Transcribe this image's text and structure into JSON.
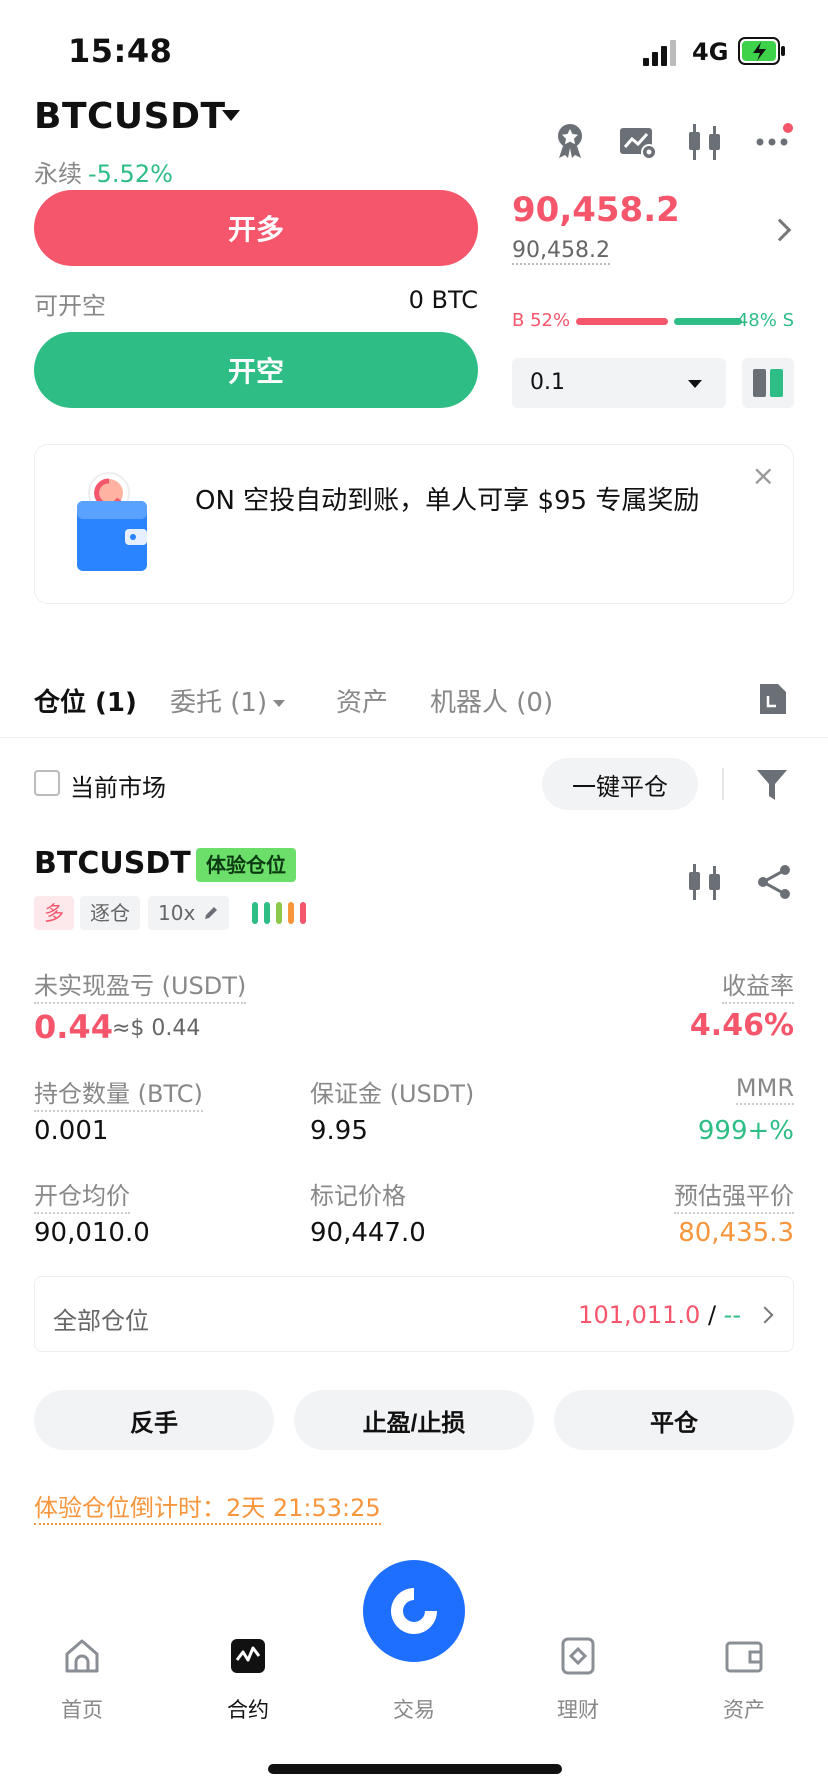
{
  "status": {
    "time": "15:48",
    "network": "4G"
  },
  "header": {
    "pair": "BTCUSDT",
    "contract_type": "永续",
    "change": "-5.52%"
  },
  "order": {
    "long_label": "开多",
    "short_label": "开空",
    "available_label": "可开空",
    "available_value": "0 BTC",
    "quantity": "0.1"
  },
  "price": {
    "last": "90,458.2",
    "mark": "90,458.2"
  },
  "ratio": {
    "buy_label": "B 52%",
    "sell_label": "48% S",
    "buy_pct": 52,
    "sell_pct": 48
  },
  "banner": {
    "text": "ON 空投自动到账，单人可享 $95 专属奖励",
    "close": "×"
  },
  "tabs": [
    {
      "label": "仓位 (1)"
    },
    {
      "label": "委托 (1)"
    },
    {
      "label": "资产"
    },
    {
      "label": "机器人 (0)"
    }
  ],
  "filter": {
    "current_market": "当前市场",
    "close_all": "一键平仓"
  },
  "position": {
    "symbol": "BTCUSDT",
    "tag": "体验仓位",
    "side": "多",
    "margin_mode": "逐仓",
    "leverage": "10x",
    "pnl_label": "未实现盈亏 (USDT)",
    "pnl": "0.44",
    "pnl_usd": "≈$ 0.44",
    "roe_label": "收益率",
    "roe": "4.46%",
    "size_label": "持仓数量 (BTC)",
    "size": "0.001",
    "margin_label": "保证金 (USDT)",
    "margin": "9.95",
    "mmr_label": "MMR",
    "mmr": "999+%",
    "entry_label": "开仓均价",
    "entry": "90,010.0",
    "mark_label": "标记价格",
    "mark": "90,447.0",
    "liq_label": "预估强平价",
    "liq": "80,435.3"
  },
  "all_positions": {
    "label": "全部仓位",
    "value": "101,011.0",
    "sep": " / ",
    "dash": "--"
  },
  "actions": {
    "reverse": "反手",
    "tpsl": "止盈/止损",
    "close": "平仓"
  },
  "countdown": "体验仓位倒计时：2天 21:53:25",
  "nav": {
    "home": "首页",
    "futures": "合约",
    "trade": "交易",
    "earn": "理财",
    "assets": "资产"
  },
  "colors": {
    "red": "#f5566b",
    "green": "#2ebd85",
    "orange": "#f7963c",
    "blue": "#1f6fff"
  }
}
